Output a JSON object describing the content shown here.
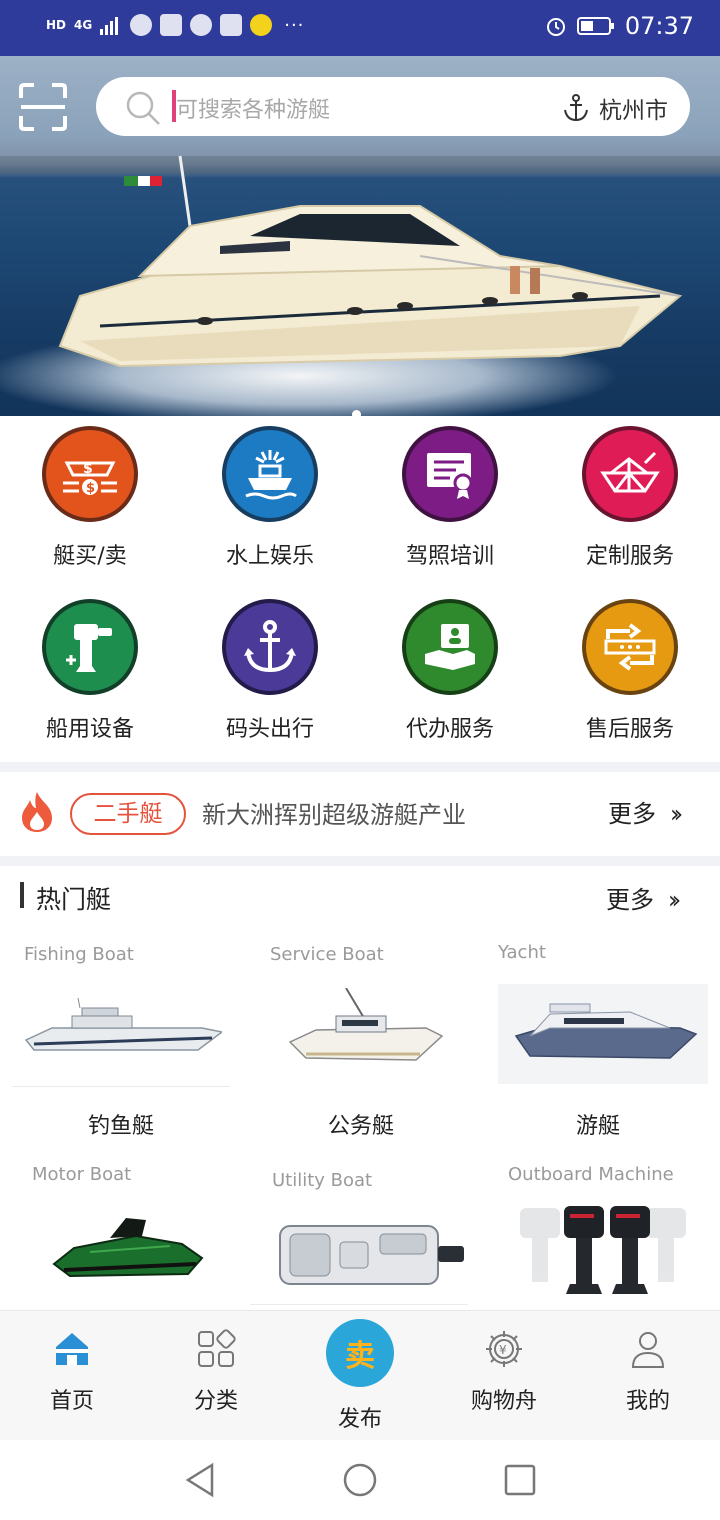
{
  "status_bar": {
    "time": "07:37",
    "hd_label": "HD",
    "network_label": "4G",
    "more_dots": "···"
  },
  "header": {
    "search_placeholder": "可搜索各种游艇",
    "city": "杭州市"
  },
  "hero": {
    "slide_count": 1,
    "active_slide": 0
  },
  "categories": [
    {
      "label": "艇买/卖",
      "icon": "boat-trade-icon",
      "color": "#e2541c"
    },
    {
      "label": "水上娱乐",
      "icon": "water-entertainment-icon",
      "color": "#1d7bc3"
    },
    {
      "label": "驾照培训",
      "icon": "certificate-icon",
      "color": "#7e1c86"
    },
    {
      "label": "定制服务",
      "icon": "paper-boat-icon",
      "color": "#e01c57"
    },
    {
      "label": "船用设备",
      "icon": "outboard-motor-icon",
      "color": "#1e8e4e"
    },
    {
      "label": "码头出行",
      "icon": "anchor-icon",
      "color": "#4b3a98"
    },
    {
      "label": "代办服务",
      "icon": "agent-service-icon",
      "color": "#2f8a2e"
    },
    {
      "label": "售后服务",
      "icon": "exchange-icon",
      "color": "#e59a12"
    }
  ],
  "news": {
    "tag": "二手艇",
    "headline": "新大洲挥别超级游艇产业",
    "more": "更多"
  },
  "hot": {
    "title": "热门艇",
    "more": "更多",
    "items": [
      {
        "en": "Fishing Boat",
        "cn": "钓鱼艇"
      },
      {
        "en": "Service Boat",
        "cn": "公务艇"
      },
      {
        "en": "Yacht",
        "cn": "游艇"
      },
      {
        "en": "Motor Boat",
        "cn": ""
      },
      {
        "en": "Utility Boat",
        "cn": ""
      },
      {
        "en": "Outboard Machine",
        "cn": ""
      }
    ]
  },
  "bottom_nav": {
    "home": "首页",
    "category": "分类",
    "publish_badge": "卖",
    "publish": "发布",
    "cart": "购物舟",
    "mine": "我的"
  },
  "colors": {
    "status_bar": "#2f3b9a",
    "accent_blue": "#2aa7d8",
    "tag_red": "#e5533d"
  }
}
